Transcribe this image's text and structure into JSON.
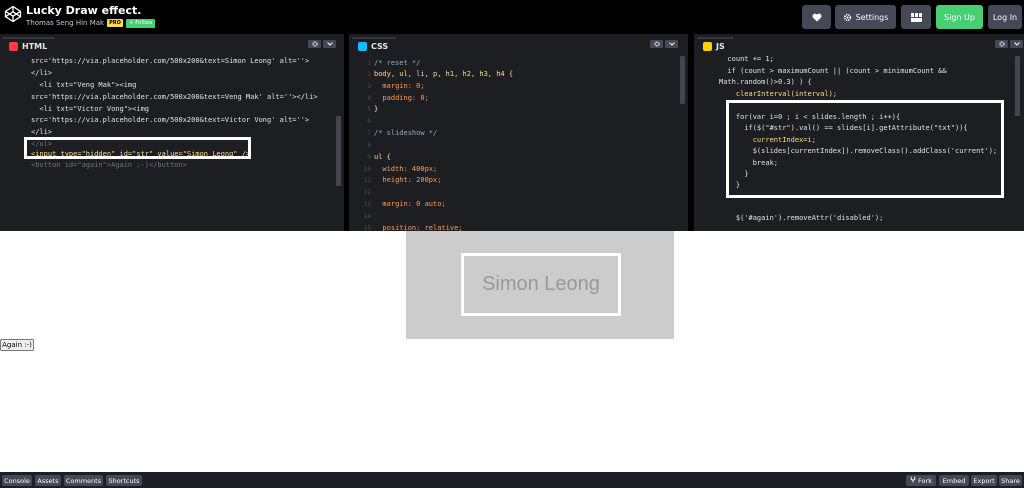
{
  "header": {
    "title": "Lucky Draw effect.",
    "author": "Thomas Seng Hin Mak",
    "pro_badge": "PRO",
    "follow_label": "+ Follow",
    "settings_label": "Settings",
    "signup_label": "Sign Up",
    "login_label": "Log In",
    "icons": [
      "codepen-logo-icon",
      "heart-icon",
      "gear-icon",
      "layout-icon"
    ]
  },
  "colors": {
    "header_bg": "#000000",
    "editor_bg": "#1d1e22",
    "accent_green": "#47cf73",
    "pro_yellow": "#ffdd40",
    "html_icon": "#ff3c41",
    "css_icon": "#0ebeff",
    "js_icon": "#fcd000",
    "slide_bg": "#cccccc",
    "slide_text": "#999999"
  },
  "editors": {
    "html": {
      "label": "HTML",
      "lines": [
        "src='https://via.placeholder.com/500x200&text=Simon Leong' alt=''>",
        "</li>",
        "  <li txt=\"Veng Mak\"><img",
        "src='https://via.placeholder.com/500x200&text=Veng Mak' alt=''></li>",
        "  <li txt=\"Victor Vong\"><img",
        "src='https://via.placeholder.com/500x200&text=Victor Vong' alt=''>",
        "</li>",
        "</ul>",
        "<input type=\"hidden\" id=\"str\" value=\"Simon Leong\" />",
        "<button id=\"again\">Again :-)</button>"
      ]
    },
    "css": {
      "label": "CSS",
      "lines": [
        "/* reset */",
        "body, ul, li, p, h1, h2, h3, h4 {",
        "  margin: 0;",
        "  padding: 0;",
        "}",
        "",
        "/* slideshow */",
        "",
        "ul {",
        "  width: 400px;",
        "  height: 200px;",
        "",
        "  margin: 0 auto;",
        "",
        "  position: relative;"
      ]
    },
    "js": {
      "label": "JS",
      "lines": [
        "  count += 1;",
        "  if (count > maximumCount || (count > minimumCount &&",
        "Math.random()>0.3) ) {",
        "    clearInterval(interval);",
        "",
        "    for(var i=0 ; i < slides.length ; i++){",
        "      if($(\"#str\").val() == slides[i].getAttribute(\"txt\")){",
        "        currentIndex=i;",
        "        $(slides[currentIndex]).removeClass().addClass('current');",
        "        break;",
        "      }",
        "    }",
        "",
        "",
        "    $('#again').removeAttr('disabled');"
      ]
    }
  },
  "preview": {
    "slide_text": "Simon Leong",
    "again_button": "Again :-)"
  },
  "footer": {
    "console": "Console",
    "assets": "Assets",
    "comments": "Comments",
    "shortcuts": "Shortcuts",
    "fork": "Fork",
    "embed": "Embed",
    "export": "Export",
    "share": "Share"
  }
}
